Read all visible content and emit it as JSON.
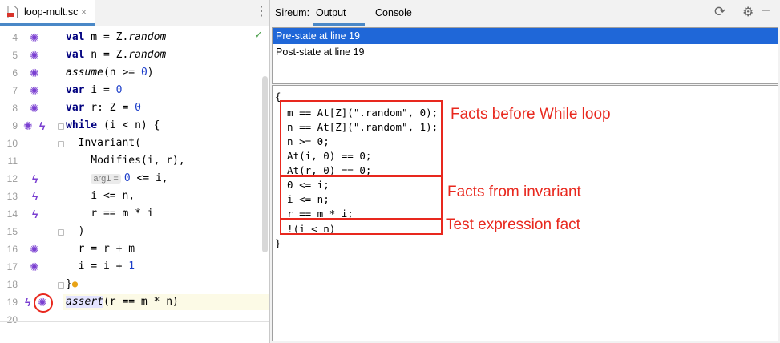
{
  "editor": {
    "file_tab": "loop-mult.sc",
    "close_glyph": "×",
    "more_glyph": "⋮",
    "check_glyph": "✓",
    "line_numbers": [
      "4",
      "5",
      "6",
      "7",
      "8",
      "9",
      "10",
      "11",
      "12",
      "13",
      "14",
      "15",
      "16",
      "17",
      "18",
      "19",
      "20"
    ],
    "lines": {
      "l4": {
        "kw": "val",
        "rest1": " m = Z.",
        "it": "random"
      },
      "l5": {
        "kw": "val",
        "rest1": " n = Z.",
        "it": "random"
      },
      "l6": {
        "it": "assume",
        "rest1": "(n >= ",
        "num": "0",
        "rest2": ")"
      },
      "l7": {
        "kw": "var",
        "rest1": " i = ",
        "num": "0"
      },
      "l8": {
        "kw": "var",
        "rest1": " r: Z = ",
        "num": "0"
      },
      "l9": {
        "kw": "while",
        "rest1": " (i < n) {"
      },
      "l10": "  Invariant(",
      "l11": "    Modifies(i, r),",
      "l12": {
        "hint": "arg1 =",
        "num": "0",
        "rest1": " <= i,"
      },
      "l13": "    i <= n,",
      "l14": "    r == m * i",
      "l15": "  )",
      "l16": {
        "rest1": "  r = r + m"
      },
      "l17": {
        "rest1": "  i = i + ",
        "num": "1"
      },
      "l18": "}",
      "l19": {
        "it": "assert",
        "rest1": "(r == m * n)"
      }
    }
  },
  "tool": {
    "title": "Sireum:",
    "tabs": [
      "Output",
      "Console"
    ],
    "active_tab": "Output",
    "list_items": [
      "Pre-state at line 19",
      "Post-state at line 19"
    ],
    "selected_index": 0,
    "detail_lines": [
      "{",
      "  m == At[Z](\".random\", 0);",
      "  n == At[Z](\".random\", 1);",
      "  n >= 0;",
      "  At(i, 0) == 0;",
      "  At(r, 0) == 0;",
      "  0 <= i;",
      "  i <= n;",
      "  r == m * i;",
      "  !(i < n)",
      "}"
    ],
    "annotations": [
      "Facts before While loop",
      "Facts from invariant",
      "Test expression fact"
    ],
    "annotation_color": "#e8281e",
    "selection_color": "#1f67d8"
  }
}
